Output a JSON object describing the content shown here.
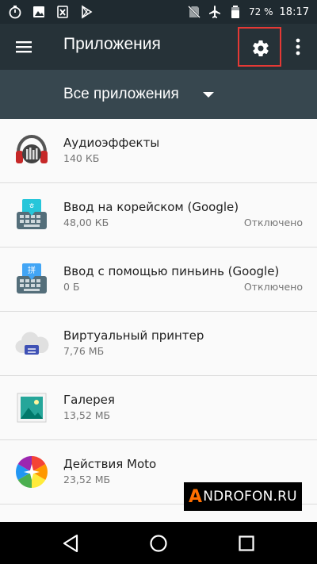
{
  "status_bar": {
    "battery_percent": "72 %",
    "time": "18:17",
    "left_icons": [
      "timer-icon",
      "image-icon",
      "excel-icon",
      "play-store-icon"
    ],
    "right_icons": [
      "no-sim-icon",
      "airplane-mode-icon",
      "battery-icon"
    ]
  },
  "app_bar": {
    "title": "Приложения",
    "icons": [
      "menu-icon",
      "settings-icon",
      "more-options-icon"
    ],
    "highlight_color": "#e53935"
  },
  "filter": {
    "label": "Все приложения"
  },
  "apps": [
    {
      "name": "Аудиоэффекты",
      "size": "140 КБ",
      "status": "",
      "icon": "audio-effects-icon"
    },
    {
      "name": "Ввод на корейском (Google)",
      "size": "48,00 КБ",
      "status": "Отключено",
      "icon": "korean-keyboard-icon"
    },
    {
      "name": "Ввод с помощью пиньинь (Google)",
      "size": "0 Б",
      "status": "Отключено",
      "icon": "pinyin-keyboard-icon"
    },
    {
      "name": "Виртуальный принтер",
      "size": "7,76 МБ",
      "status": "",
      "icon": "cloud-print-icon"
    },
    {
      "name": "Галерея",
      "size": "13,52 МБ",
      "status": "",
      "icon": "gallery-icon"
    },
    {
      "name": "Действия Moto",
      "size": "23,52 МБ",
      "status": "",
      "icon": "moto-actions-icon"
    }
  ],
  "watermark": {
    "accent": "A",
    "text": "NDROFON.RU"
  },
  "nav_bar": {
    "icons": [
      "back-icon",
      "home-icon",
      "recents-icon"
    ]
  },
  "colors": {
    "status_bar": "#1f2a30",
    "app_bar": "#263238",
    "filter_bar": "#37474f",
    "watermark_accent": "#ff6f00"
  }
}
